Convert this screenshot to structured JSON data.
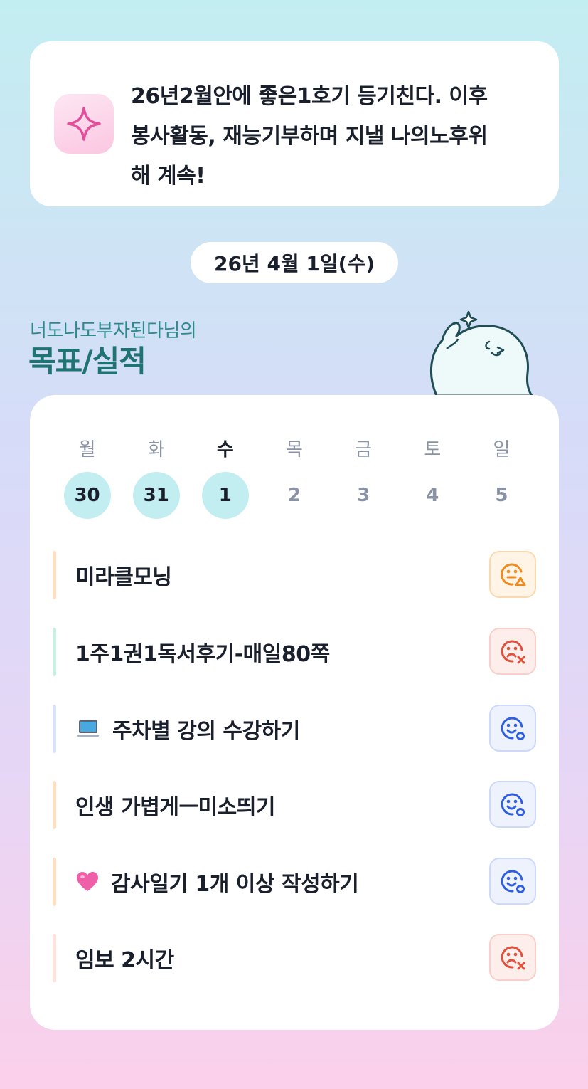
{
  "goal": {
    "line1": "26년2월안에 좋은1호기 등기친다. 이후",
    "line2": "봉사활동, 재능기부하며 지낼 나의노후위",
    "line3": "해 계속!",
    "icon": "sparkle-icon"
  },
  "date": "26년 4월 1일(수)",
  "owner": "너도나도부자된다님의",
  "section_title": "목표/실적",
  "week": {
    "weekdays": [
      "월",
      "화",
      "수",
      "목",
      "금",
      "토",
      "일"
    ],
    "days": [
      "30",
      "31",
      "1",
      "2",
      "3",
      "4",
      "5"
    ],
    "today_index": 2
  },
  "habits": [
    {
      "label": "미라클모닝",
      "status": "warning",
      "icon": "face-warning-icon",
      "accent": "#fde0c2"
    },
    {
      "label": "1주1권1독서후기-매일80쪽",
      "status": "failed",
      "icon": "face-failed-icon",
      "accent": "#c8efe0"
    },
    {
      "label": "주차별 강의 수강하기",
      "emoji": "laptop-icon",
      "status": "done",
      "icon": "face-done-icon",
      "accent": "#d9e1f7"
    },
    {
      "label": "인생 가볍게ㅡ미소띄기",
      "status": "done",
      "icon": "face-done-icon",
      "accent": "#fde0c2"
    },
    {
      "label": "감사일기 1개 이상 작성하기",
      "emoji": "heart-icon",
      "status": "done",
      "icon": "face-done-icon",
      "accent": "#fde0c2"
    },
    {
      "label": "임보 2시간",
      "status": "failed",
      "icon": "face-failed-icon",
      "accent": "#fde2dd"
    }
  ],
  "colors": {
    "warning": "#f08a1c",
    "failed": "#e0503c",
    "done": "#2f5fe0",
    "title": "#1f7372",
    "today_circle": "#c3eef1"
  }
}
